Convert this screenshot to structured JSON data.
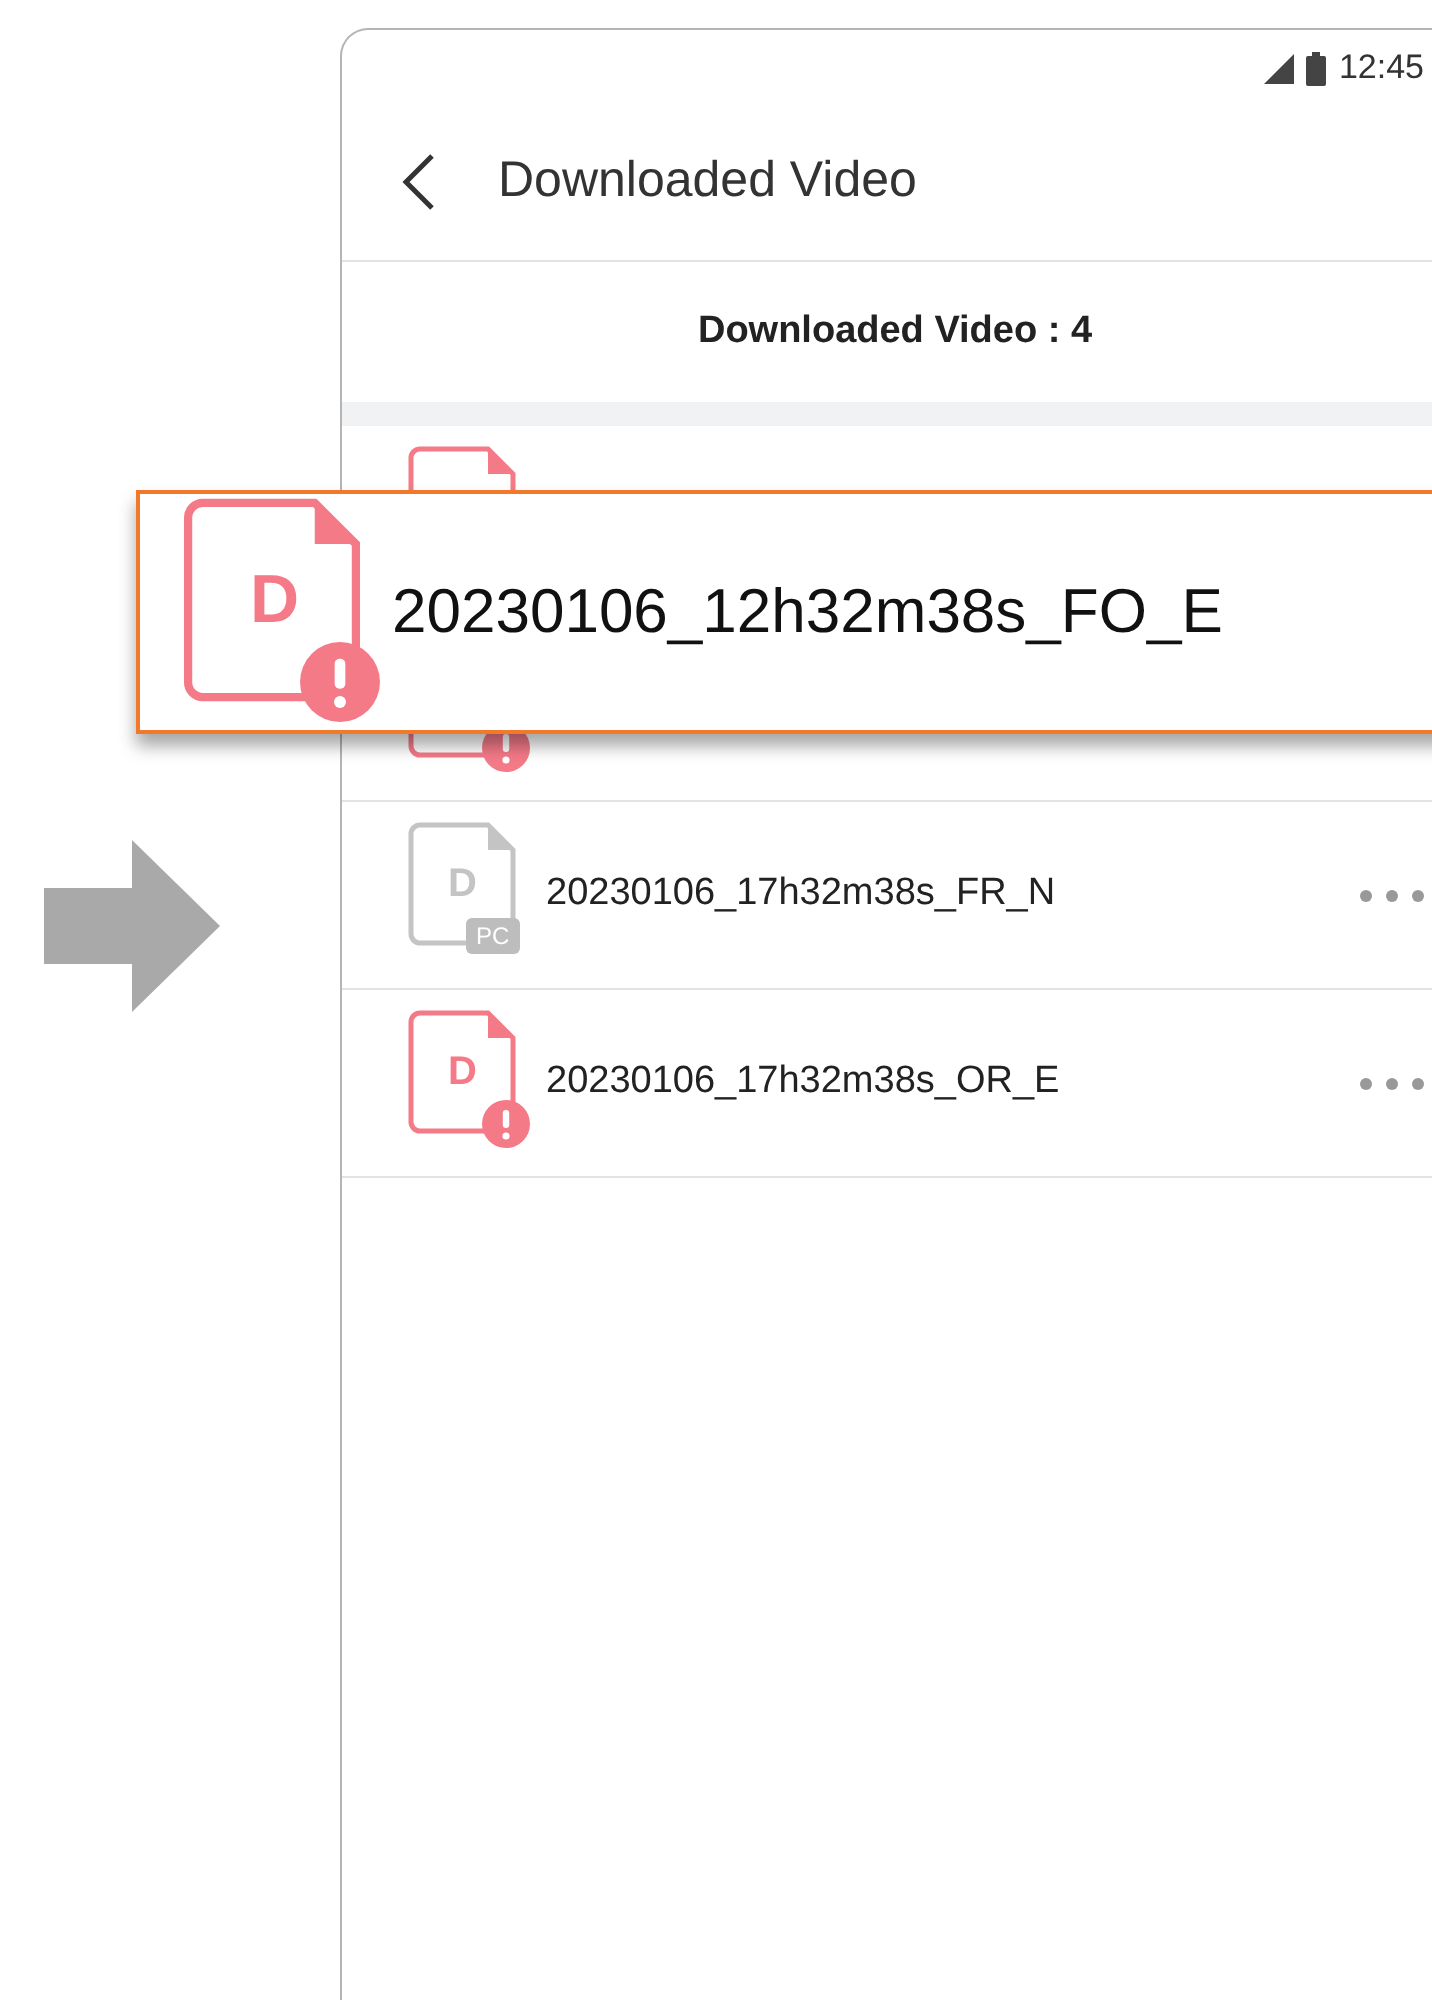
{
  "status_bar": {
    "time": "12:45"
  },
  "header": {
    "title": "Downloaded Video"
  },
  "counter": "Downloaded Video : 4",
  "files": [
    {
      "kind": "error",
      "alert": false
    },
    {
      "kind": "error",
      "alert": true
    },
    {
      "kind": "pc",
      "alert": false,
      "letter": "D",
      "badge": "PC",
      "name": "20230106_17h32m38s_FR_N"
    },
    {
      "kind": "error",
      "alert": true,
      "letter": "D",
      "name": "20230106_17h32m38s_OR_E"
    }
  ],
  "zoom_popup": {
    "kind": "error",
    "alert": true,
    "letter": "D",
    "name": "20230106_12h32m38s_FO_E"
  }
}
